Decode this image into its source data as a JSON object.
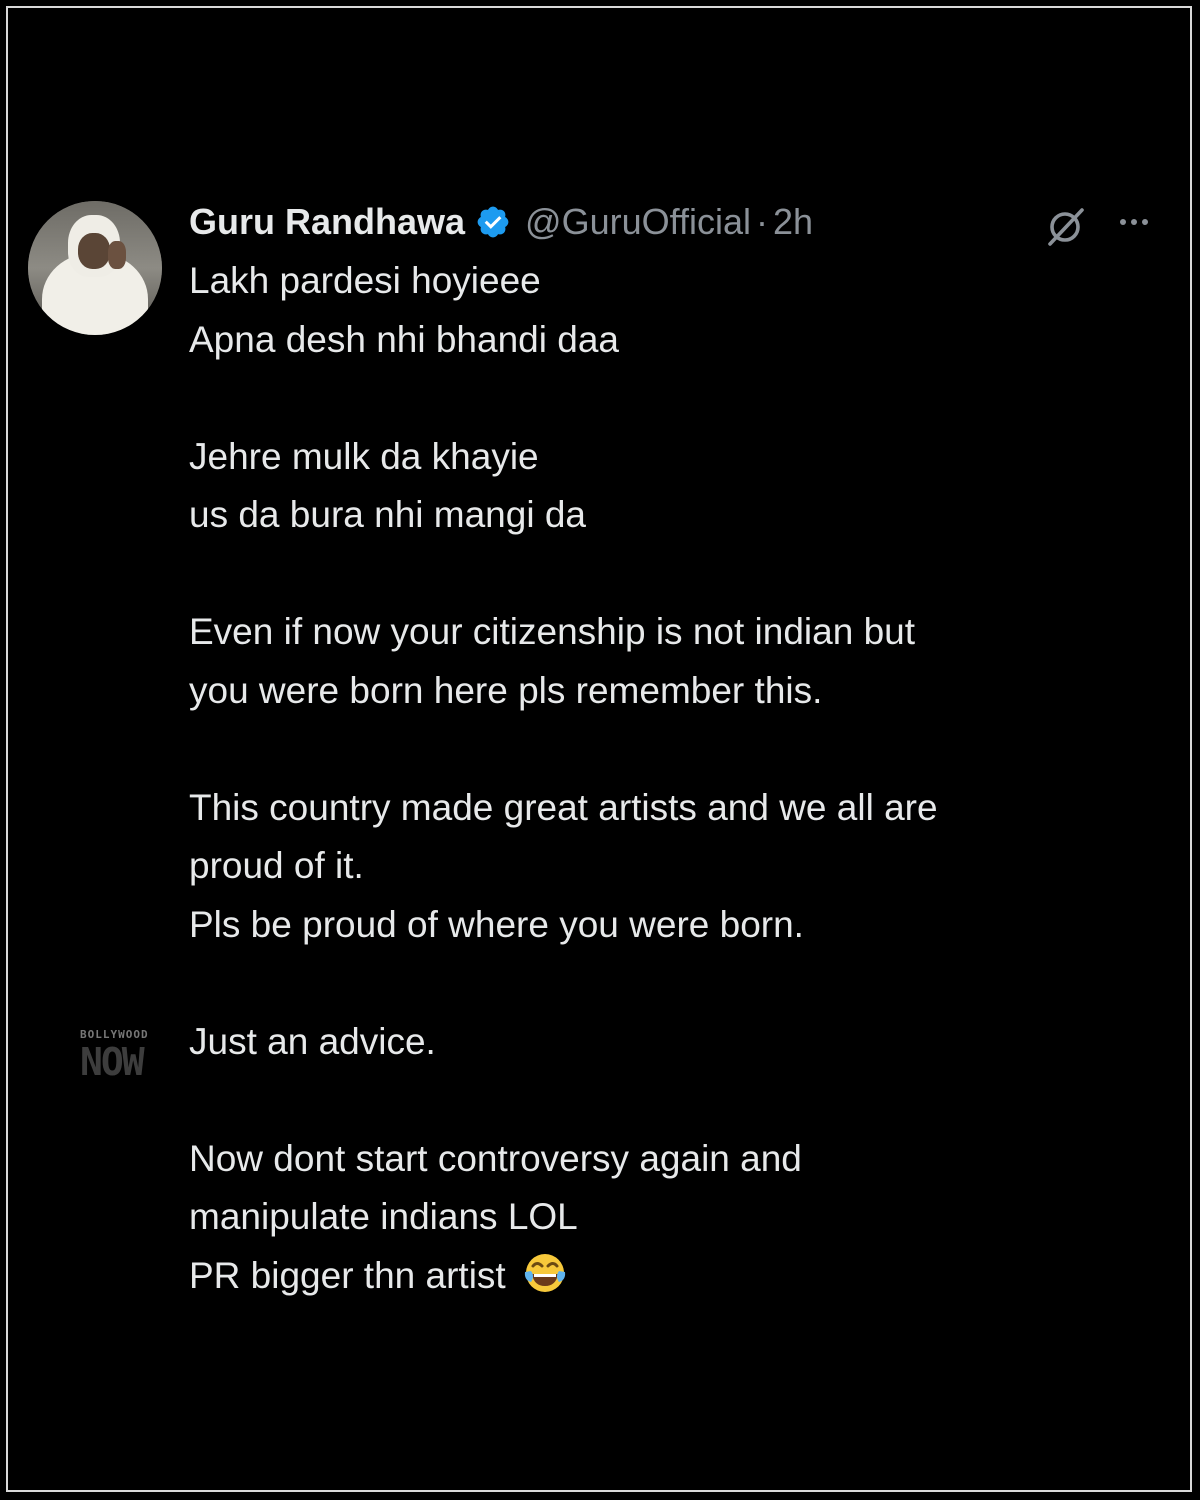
{
  "tweet": {
    "author_name": "Guru Randhawa",
    "handle": "@GuruOfficial",
    "separator": "·",
    "time": "2h",
    "lines": [
      "Lakh pardesi hoyieee",
      "Apna desh nhi bhandi daa",
      "",
      "Jehre mulk da khayie",
      "us da bura nhi mangi da",
      "",
      "Even if now your citizenship is not indian but",
      "you were born here pls remember this.",
      "",
      "This country made great artists and we all are",
      "proud of it.",
      "Pls be proud of where you were born.",
      "",
      "Just an advice.",
      "",
      "Now dont start controversy again and",
      "manipulate indians LOL",
      "PR bigger thn artist"
    ],
    "closing_emoji": "face-with-tears-of-joy",
    "icons": {
      "verified": "verified-badge-icon",
      "grok": "grok-icon",
      "more": "more-options-icon"
    }
  },
  "watermark": {
    "top": "BOLLYWOOD",
    "main": "NOW"
  },
  "colors": {
    "background": "#000000",
    "text": "#e7e9ea",
    "secondary": "#8b9198",
    "verified": "#1d9bf0",
    "frame": "#d9d9d9"
  }
}
